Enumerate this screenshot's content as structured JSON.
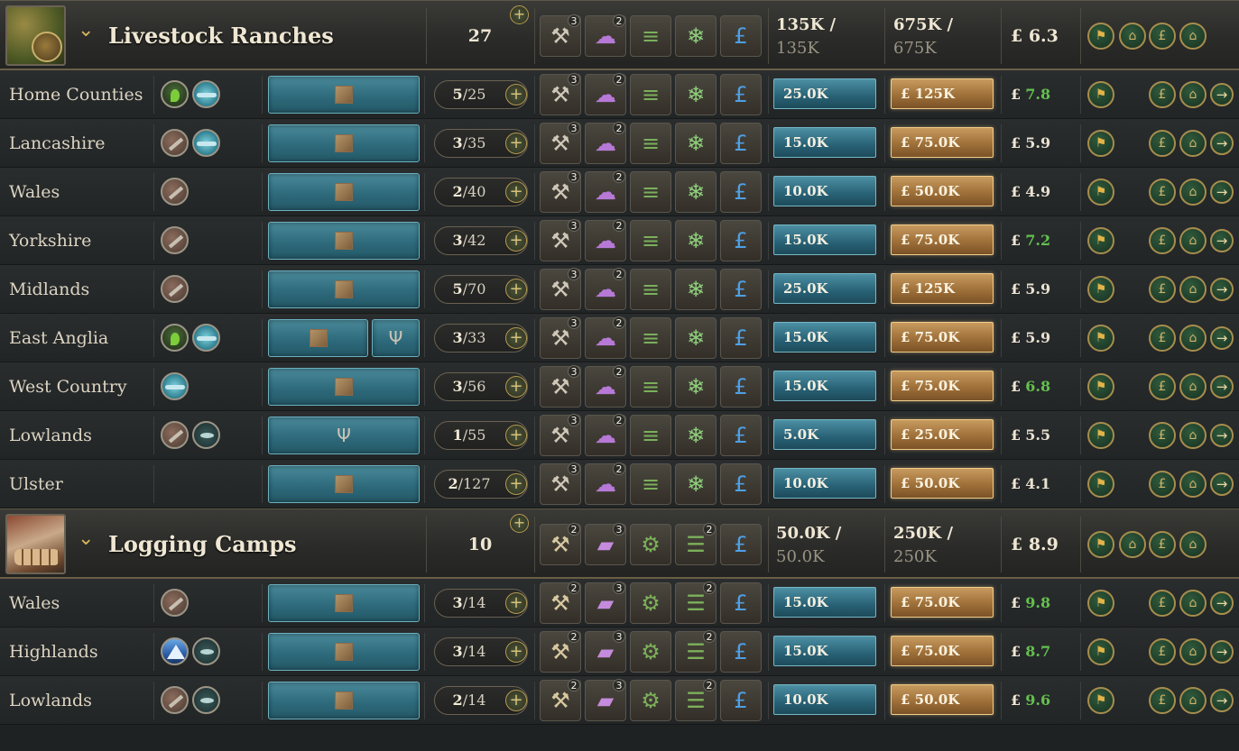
{
  "colors": {
    "growth": "#63c14d",
    "employment": "#2e6b7c",
    "capacity": "#9b6d37",
    "accent": "#d6b45a"
  },
  "groups": [
    {
      "title": "Livestock Ranches",
      "thumbnail": "ranch-thumbnail",
      "count": "27",
      "employment_line1": "135K /",
      "employment_line2": "135K",
      "capacity_line1": "675K /",
      "capacity_line2": "675K",
      "productivity": "£ 6.3",
      "production_methods": [
        {
          "icon": "pickaxe-icon",
          "badge": "3"
        },
        {
          "icon": "sheep-icon",
          "badge": "2"
        },
        {
          "icon": "fence-icon",
          "badge": ""
        },
        {
          "icon": "snowflake-icon",
          "badge": ""
        },
        {
          "icon": "pound-hand-icon",
          "badge": ""
        }
      ],
      "rows": [
        {
          "name": "Home Counties",
          "resources": [
            "plant",
            "water"
          ],
          "slots": [
            "crate"
          ],
          "level": "5",
          "max": "25",
          "employment": "25.0K",
          "capacity": "£ 125K",
          "cur": "£",
          "val": "7.8",
          "green": true
        },
        {
          "name": "Lancashire",
          "resources": [
            "pick",
            "water"
          ],
          "slots": [
            "crate"
          ],
          "level": "3",
          "max": "35",
          "employment": "15.0K",
          "capacity": "£ 75.0K",
          "cur": "£",
          "val": "5.9",
          "green": false
        },
        {
          "name": "Wales",
          "resources": [
            "pick"
          ],
          "slots": [
            "crate"
          ],
          "level": "2",
          "max": "40",
          "employment": "10.0K",
          "capacity": "£ 50.0K",
          "cur": "£",
          "val": "4.9",
          "green": false
        },
        {
          "name": "Yorkshire",
          "resources": [
            "pick"
          ],
          "slots": [
            "crate"
          ],
          "level": "3",
          "max": "42",
          "employment": "15.0K",
          "capacity": "£ 75.0K",
          "cur": "£",
          "val": "7.2",
          "green": true
        },
        {
          "name": "Midlands",
          "resources": [
            "pick"
          ],
          "slots": [
            "crate"
          ],
          "level": "5",
          "max": "70",
          "employment": "25.0K",
          "capacity": "£ 125K",
          "cur": "£",
          "val": "5.9",
          "green": false
        },
        {
          "name": "East Anglia",
          "resources": [
            "plant",
            "water"
          ],
          "slots": [
            "crate",
            "fork"
          ],
          "level": "3",
          "max": "33",
          "employment": "15.0K",
          "capacity": "£ 75.0K",
          "cur": "£",
          "val": "5.9",
          "green": false
        },
        {
          "name": "West Country",
          "resources": [
            "water"
          ],
          "slots": [
            "crate"
          ],
          "level": "3",
          "max": "56",
          "employment": "15.0K",
          "capacity": "£ 75.0K",
          "cur": "£",
          "val": "6.8",
          "green": true
        },
        {
          "name": "Lowlands",
          "resources": [
            "pick",
            "fish"
          ],
          "slots": [
            "fork"
          ],
          "level": "1",
          "max": "55",
          "employment": "5.0K",
          "capacity": "£ 25.0K",
          "cur": "£",
          "val": "5.5",
          "green": false
        },
        {
          "name": "Ulster",
          "resources": [],
          "slots": [
            "crate"
          ],
          "level": "2",
          "max": "127",
          "employment": "10.0K",
          "capacity": "£ 50.0K",
          "cur": "£",
          "val": "4.1",
          "green": false
        }
      ]
    },
    {
      "title": "Logging Camps",
      "thumbnail": "logging-thumbnail",
      "count": "10",
      "employment_line1": "50.0K /",
      "employment_line2": "50.0K",
      "capacity_line1": "250K /",
      "capacity_line2": "250K",
      "productivity": "£ 8.9",
      "production_methods": [
        {
          "icon": "saw-icon",
          "badge": "2"
        },
        {
          "icon": "planks-icon",
          "badge": "3"
        },
        {
          "icon": "gear-icon",
          "badge": ""
        },
        {
          "icon": "ladder-icon",
          "badge": "2"
        },
        {
          "icon": "pound-hand-icon",
          "badge": ""
        }
      ],
      "rows": [
        {
          "name": "Wales",
          "resources": [
            "pick"
          ],
          "slots": [
            "log"
          ],
          "level": "3",
          "max": "14",
          "employment": "15.0K",
          "capacity": "£ 75.0K",
          "cur": "£",
          "val": "9.8",
          "green": true
        },
        {
          "name": "Highlands",
          "resources": [
            "mount",
            "fish"
          ],
          "slots": [
            "log"
          ],
          "level": "3",
          "max": "14",
          "employment": "15.0K",
          "capacity": "£ 75.0K",
          "cur": "£",
          "val": "8.7",
          "green": true
        },
        {
          "name": "Lowlands",
          "resources": [
            "pick",
            "fish"
          ],
          "slots": [
            "log"
          ],
          "level": "2",
          "max": "14",
          "employment": "10.0K",
          "capacity": "£ 50.0K",
          "cur": "£",
          "val": "9.6",
          "green": true
        }
      ]
    }
  ]
}
